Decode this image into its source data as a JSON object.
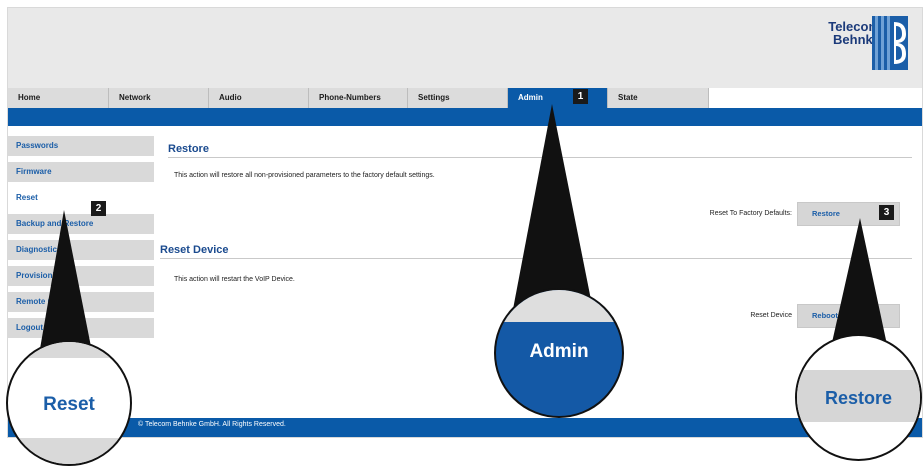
{
  "header": {
    "logo_line1": "Telecom",
    "logo_line2": "Behnke",
    "brand_color": "#0a5aa8"
  },
  "tabs": [
    {
      "label": "Home"
    },
    {
      "label": "Network"
    },
    {
      "label": "Audio"
    },
    {
      "label": "Phone-Numbers"
    },
    {
      "label": "Settings"
    },
    {
      "label": "Admin",
      "active": true
    },
    {
      "label": "State"
    }
  ],
  "sidebar": {
    "items": [
      {
        "label": "Passwords"
      },
      {
        "label": "Firmware"
      },
      {
        "label": "Reset",
        "active": true
      },
      {
        "label": "Backup and Restore"
      },
      {
        "label": "Diagnostics"
      },
      {
        "label": "Provisioning"
      },
      {
        "label": "Remote Control"
      },
      {
        "label": "Logout"
      }
    ]
  },
  "restore_section": {
    "title": "Restore",
    "description": "This action will restore all non-provisioned parameters to the factory default settings.",
    "field_label": "Reset To Factory Defaults:",
    "button_label": "Restore"
  },
  "reset_section": {
    "title": "Reset Device",
    "description": "This action will restart the VoIP Device.",
    "field_label": "Reset Device",
    "button_label": "Reboot"
  },
  "footer": {
    "text": "© Telecom Behnke GmbH. All Rights Reserved."
  },
  "annotations": {
    "marker1": "1",
    "marker2": "2",
    "marker3": "3",
    "zoom_admin": "Admin",
    "zoom_reset": "Reset",
    "zoom_restore": "Restore"
  }
}
